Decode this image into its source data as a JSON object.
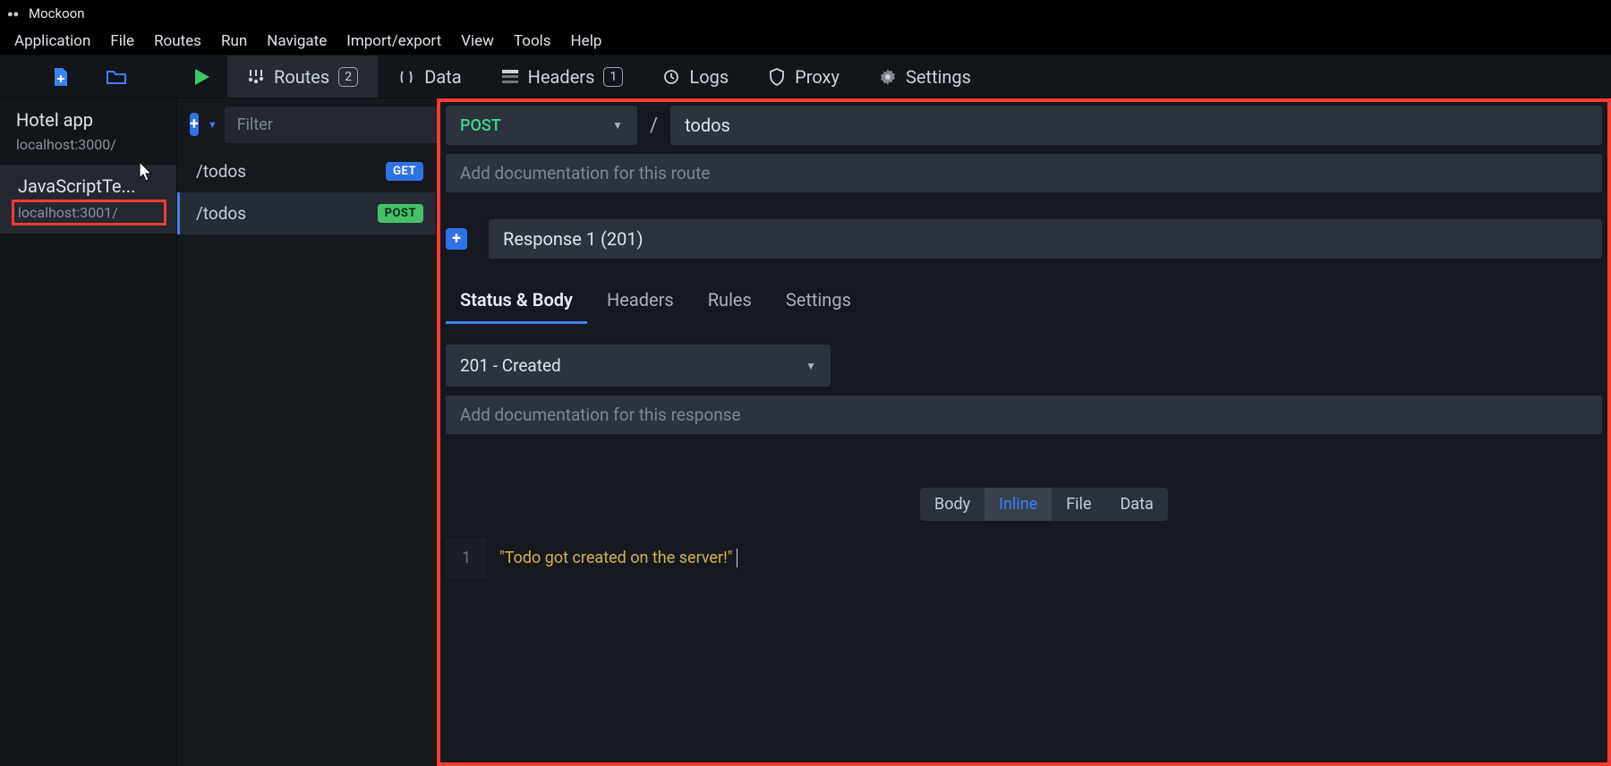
{
  "titlebar": {
    "title": "Mockoon"
  },
  "menubar": {
    "items": [
      "Application",
      "File",
      "Routes",
      "Run",
      "Navigate",
      "Import/export",
      "View",
      "Tools",
      "Help"
    ]
  },
  "toolbar": {
    "tabs": [
      {
        "id": "routes",
        "label": "Routes",
        "badge": "2",
        "active": true
      },
      {
        "id": "data",
        "label": "Data",
        "badge": null,
        "active": false
      },
      {
        "id": "headers",
        "label": "Headers",
        "badge": "1",
        "active": false
      },
      {
        "id": "logs",
        "label": "Logs",
        "badge": null,
        "active": false
      },
      {
        "id": "proxy",
        "label": "Proxy",
        "badge": null,
        "active": false
      },
      {
        "id": "settings",
        "label": "Settings",
        "badge": null,
        "active": false
      }
    ]
  },
  "environments": [
    {
      "name": "Hotel app",
      "host": "localhost:3000/",
      "active": false,
      "highlight": false
    },
    {
      "name": "JavaScriptTe...",
      "host": "localhost:3001/",
      "active": true,
      "highlight": true
    }
  ],
  "routesPane": {
    "filter_placeholder": "Filter",
    "add_label": "+",
    "routes": [
      {
        "path": "/todos",
        "method": "GET",
        "active": false
      },
      {
        "path": "/todos",
        "method": "POST",
        "active": true
      }
    ]
  },
  "detail": {
    "method": "POST",
    "slash": "/",
    "path": "todos",
    "route_doc_placeholder": "Add documentation for this route",
    "response_select": "Response 1 (201)",
    "sub_tabs": [
      "Status & Body",
      "Headers",
      "Rules",
      "Settings"
    ],
    "sub_tab_active": 0,
    "status_select": "201 - Created",
    "response_doc_placeholder": "Add documentation for this response",
    "body_types": {
      "label": "Body",
      "items": [
        "Inline",
        "File",
        "Data"
      ],
      "active": 0
    },
    "editor": {
      "line_num": "1",
      "code": "\"Todo got created on the server!\""
    }
  },
  "colors": {
    "accent_blue": "#3b82f6",
    "accent_green": "#43c16b",
    "annotation_red": "#ff3b2f",
    "bg": "#161a20"
  }
}
